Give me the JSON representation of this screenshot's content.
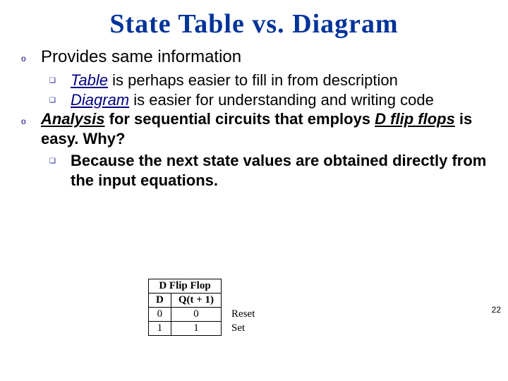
{
  "title": "State Table vs. Diagram",
  "page_number": "22",
  "bullets": {
    "l1a": "Provides same information",
    "l2a_em": "Table",
    "l2a_rest": " is perhaps easier to fill in from description",
    "l2b_em": "Diagram",
    "l2b_rest": " is easier for understanding and writing code",
    "l1b_em1": "Analysis",
    "l1b_mid": " for sequential circuits that employs ",
    "l1b_em2": "D flip flops",
    "l1b_end": " is easy. Why?",
    "l2c": "Because the next state values are obtained directly from the input equations."
  },
  "table": {
    "caption": "D Flip Flop",
    "head_d": "D",
    "head_q": "Q(t + 1)",
    "r1_d": "0",
    "r1_q": "0",
    "r1_lbl": "Reset",
    "r2_d": "1",
    "r2_q": "1",
    "r2_lbl": "Set"
  }
}
